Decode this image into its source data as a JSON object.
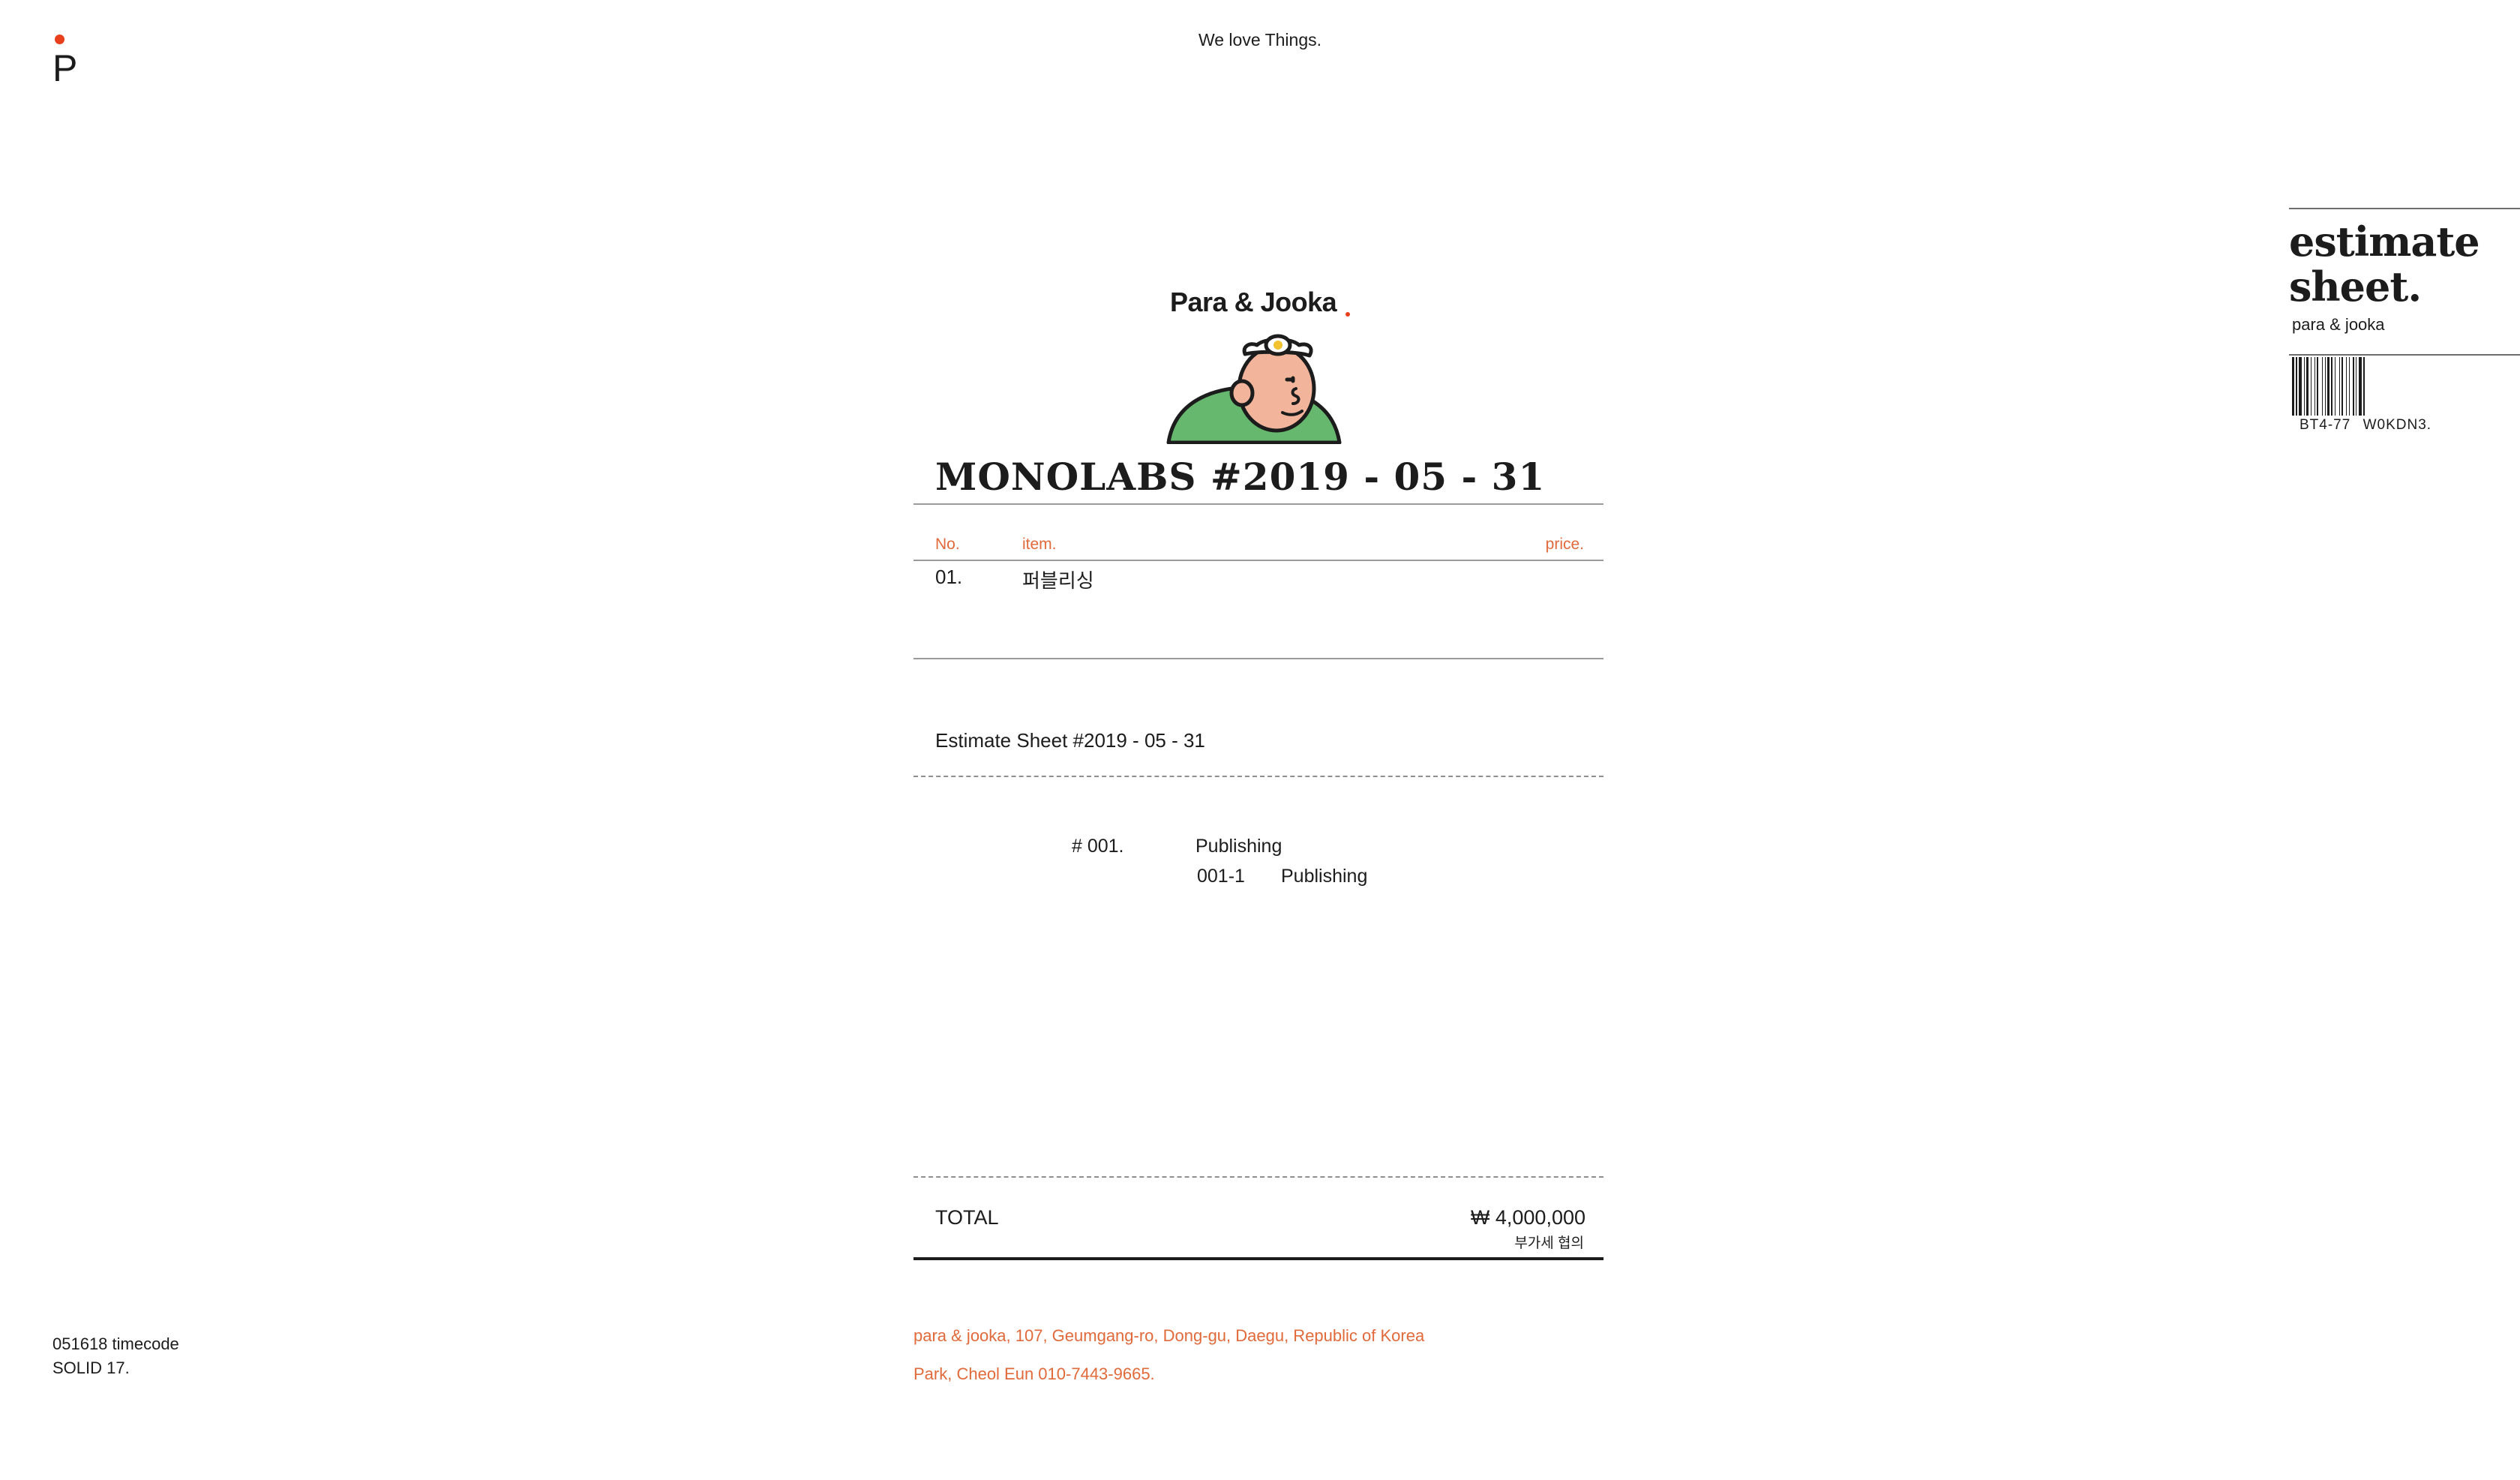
{
  "header": {
    "logo_letter": "P",
    "tagline": "We love Things."
  },
  "side_panel": {
    "title_line1": "estimate",
    "title_line2": "sheet.",
    "subtitle": "para & jooka",
    "barcode_text": "BT4-77 W0KDN3."
  },
  "document": {
    "brand": "Para & Jooka",
    "title": "MONOLABS #2019 - 05 - 31",
    "table": {
      "headers": {
        "no": "No.",
        "item": "item.",
        "price": "price."
      },
      "rows": [
        {
          "no": "01.",
          "item": "퍼블리싱",
          "price": ""
        }
      ]
    },
    "estimate_sheet": "Estimate Sheet #2019 - 05 - 31",
    "sections": [
      {
        "num": "# 001.",
        "name": "Publishing",
        "sub": [
          {
            "num": "001-1",
            "name": "Publishing"
          }
        ]
      }
    ],
    "total": {
      "label": "TOTAL",
      "amount": "₩ 4,000,000",
      "vat_note": "부가세 협의"
    },
    "footer": {
      "address": "para & jooka, 107, Geumgang-ro, Dong-gu, Daegu, Republic of Korea",
      "contact": "Park, Cheol Eun 010-7443-9665."
    }
  },
  "bottom_left": {
    "line1": "051618 timecode",
    "line2": "SOLID 17."
  },
  "colors": {
    "accent_orange": "#e06a3a",
    "logo_red": "#e8401c",
    "text_dark": "#1c1c1c",
    "mascot_green": "#66b86e",
    "mascot_skin": "#f3b49c"
  }
}
